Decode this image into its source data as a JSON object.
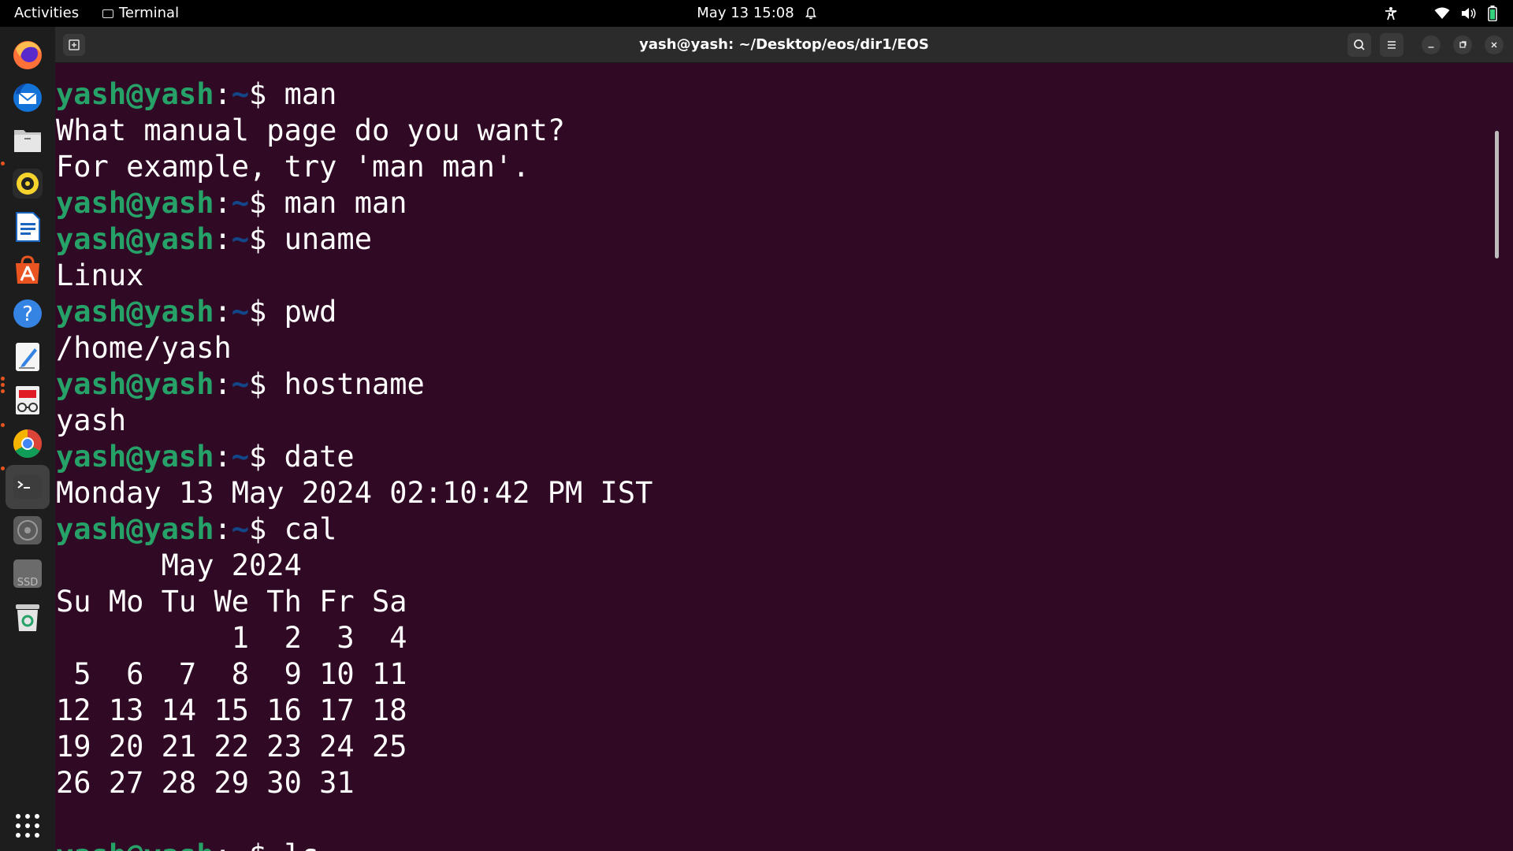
{
  "topbar": {
    "activities": "Activities",
    "app_name": "Terminal",
    "clock": "May 13  15:08",
    "icons": [
      "bell-icon",
      "accessibility-icon",
      "wifi-icon",
      "volume-icon",
      "battery-icon"
    ]
  },
  "dock": {
    "items": [
      "firefox-icon",
      "thunderbird-icon",
      "files-icon",
      "rhythmbox-icon",
      "libreoffice-writer-icon",
      "app-center-icon",
      "help-icon",
      "text-editor-icon",
      "document-viewer-icon",
      "chrome-icon",
      "terminal-icon",
      "disc-drive-icon",
      "ssd-drive-icon",
      "trash-icon",
      "show-apps-icon"
    ],
    "ssd_label": "SSD"
  },
  "window": {
    "title": "yash@yash: ~/Desktop/eos/dir1/EOS"
  },
  "terminal": {
    "prompt_user": "yash@yash",
    "prompt_path": "~",
    "prompt_symbol": "$ ",
    "lines": [
      {
        "type": "cmd",
        "text": "man"
      },
      {
        "type": "out",
        "text": "What manual page do you want?"
      },
      {
        "type": "out",
        "text": "For example, try 'man man'."
      },
      {
        "type": "cmd",
        "text": "man man"
      },
      {
        "type": "cmd",
        "text": "uname"
      },
      {
        "type": "out",
        "text": "Linux"
      },
      {
        "type": "cmd",
        "text": "pwd"
      },
      {
        "type": "out",
        "text": "/home/yash"
      },
      {
        "type": "cmd",
        "text": "hostname"
      },
      {
        "type": "out",
        "text": "yash"
      },
      {
        "type": "cmd",
        "text": "date"
      },
      {
        "type": "out",
        "text": "Monday 13 May 2024 02:10:42 PM IST"
      },
      {
        "type": "cmd",
        "text": "cal"
      },
      {
        "type": "out",
        "text": "      May 2024"
      },
      {
        "type": "out",
        "text": "Su Mo Tu We Th Fr Sa"
      },
      {
        "type": "out",
        "text": "          1  2  3  4"
      },
      {
        "type": "out",
        "text": " 5  6  7  8  9 10 11"
      },
      {
        "type": "out",
        "text": "12 13 14 15 16 17 18"
      },
      {
        "type": "out",
        "text": "19 20 21 22 23 24 25"
      },
      {
        "type": "out",
        "text": "26 27 28 29 30 31"
      },
      {
        "type": "out",
        "text": ""
      },
      {
        "type": "cmd",
        "text": "ls"
      }
    ]
  },
  "colors": {
    "terminal_bg": "#300a24",
    "prompt_user": "#26a269",
    "prompt_path": "#12488b",
    "dock_bg": "#1d1d1d",
    "accent": "#e95420"
  }
}
